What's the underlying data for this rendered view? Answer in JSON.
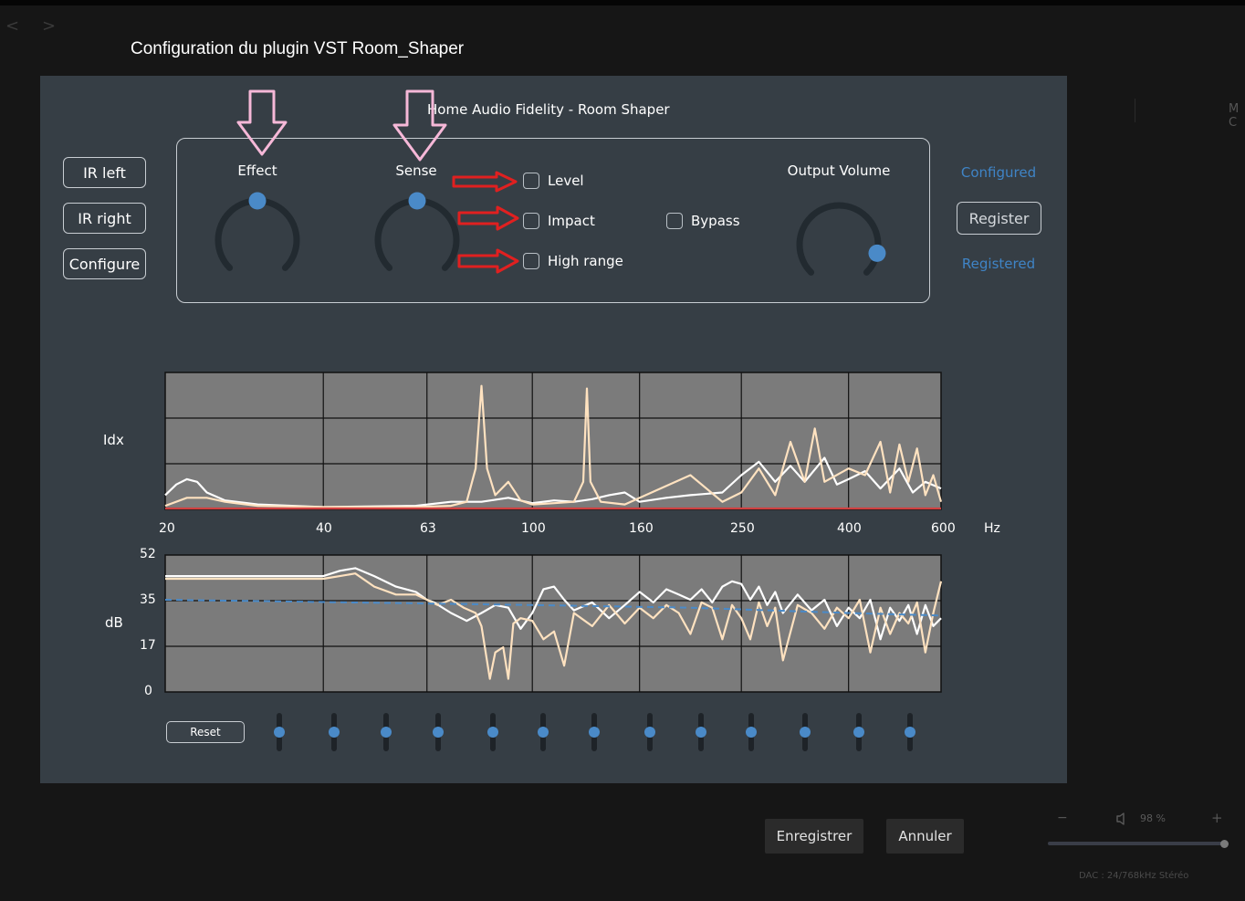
{
  "window": {
    "title": "Configuration du plugin VST Room_Shaper",
    "nav_back": "<",
    "nav_forward": ">",
    "right_edge_text": "M C"
  },
  "plugin": {
    "title": "Home Audio Fidelity - Room Shaper",
    "side_buttons": [
      "IR left",
      "IR right",
      "Configure"
    ],
    "knobs": {
      "effect": {
        "label": "Effect",
        "value": 0.5
      },
      "sense": {
        "label": "Sense",
        "value": 0.5
      },
      "output_volume": {
        "label": "Output Volume",
        "value": 0.88
      }
    },
    "checkboxes": {
      "level": {
        "label": "Level",
        "checked": false
      },
      "impact": {
        "label": "Impact",
        "checked": false
      },
      "high_range": {
        "label": "High range",
        "checked": false
      },
      "bypass": {
        "label": "Bypass",
        "checked": false
      }
    },
    "status": {
      "configured": "Configured",
      "register_button": "Register",
      "registered": "Registered"
    },
    "reset_label": "Reset",
    "eq_slider_values": [
      0.5,
      0.5,
      0.5,
      0.5,
      0.5,
      0.5,
      0.5,
      0.5,
      0.5,
      0.5,
      0.5,
      0.5,
      0.5
    ]
  },
  "chart_data": [
    {
      "type": "line",
      "ylabel": "Idx",
      "xlabel": "Hz",
      "x_scale": "log",
      "x_ticks": [
        "20",
        "40",
        "63",
        "100",
        "160",
        "250",
        "400",
        "600"
      ],
      "xlim": [
        20,
        600
      ],
      "series": [
        {
          "color": "#ffffff",
          "points": [
            [
              20,
              0.1
            ],
            [
              21,
              0.18
            ],
            [
              22,
              0.22
            ],
            [
              23,
              0.2
            ],
            [
              24,
              0.12
            ],
            [
              26,
              0.06
            ],
            [
              30,
              0.03
            ],
            [
              40,
              0.01
            ],
            [
              60,
              0.02
            ],
            [
              70,
              0.05
            ],
            [
              80,
              0.05
            ],
            [
              90,
              0.08
            ],
            [
              100,
              0.04
            ],
            [
              110,
              0.06
            ],
            [
              120,
              0.05
            ],
            [
              130,
              0.07
            ],
            [
              140,
              0.1
            ],
            [
              150,
              0.12
            ],
            [
              160,
              0.05
            ],
            [
              180,
              0.08
            ],
            [
              200,
              0.1
            ],
            [
              230,
              0.12
            ],
            [
              250,
              0.25
            ],
            [
              270,
              0.35
            ],
            [
              290,
              0.2
            ],
            [
              310,
              0.32
            ],
            [
              330,
              0.2
            ],
            [
              360,
              0.38
            ],
            [
              380,
              0.18
            ],
            [
              400,
              0.22
            ],
            [
              430,
              0.28
            ],
            [
              460,
              0.15
            ],
            [
              500,
              0.3
            ],
            [
              530,
              0.12
            ],
            [
              560,
              0.2
            ],
            [
              600,
              0.15
            ]
          ]
        },
        {
          "color": "#ffe2c0",
          "points": [
            [
              20,
              0.02
            ],
            [
              22,
              0.08
            ],
            [
              24,
              0.08
            ],
            [
              26,
              0.05
            ],
            [
              30,
              0.02
            ],
            [
              40,
              0.01
            ],
            [
              60,
              0.01
            ],
            [
              70,
              0.02
            ],
            [
              75,
              0.05
            ],
            [
              78,
              0.3
            ],
            [
              80,
              0.92
            ],
            [
              82,
              0.3
            ],
            [
              85,
              0.1
            ],
            [
              90,
              0.2
            ],
            [
              95,
              0.06
            ],
            [
              100,
              0.03
            ],
            [
              110,
              0.04
            ],
            [
              120,
              0.05
            ],
            [
              125,
              0.2
            ],
            [
              127,
              0.9
            ],
            [
              129,
              0.2
            ],
            [
              135,
              0.05
            ],
            [
              150,
              0.03
            ],
            [
              200,
              0.25
            ],
            [
              230,
              0.05
            ],
            [
              250,
              0.12
            ],
            [
              270,
              0.3
            ],
            [
              290,
              0.1
            ],
            [
              310,
              0.5
            ],
            [
              330,
              0.2
            ],
            [
              345,
              0.6
            ],
            [
              360,
              0.2
            ],
            [
              400,
              0.3
            ],
            [
              430,
              0.25
            ],
            [
              460,
              0.5
            ],
            [
              480,
              0.12
            ],
            [
              500,
              0.48
            ],
            [
              520,
              0.2
            ],
            [
              540,
              0.45
            ],
            [
              560,
              0.1
            ],
            [
              580,
              0.25
            ],
            [
              600,
              0.05
            ]
          ]
        },
        {
          "color": "#d04040",
          "points": [
            [
              20,
              0.0
            ],
            [
              600,
              0.0
            ]
          ]
        }
      ]
    },
    {
      "type": "line",
      "ylabel": "dB",
      "y_ticks": [
        "52",
        "35",
        "17",
        "0"
      ],
      "ylim": [
        0,
        52
      ],
      "x_scale": "log",
      "xlim": [
        20,
        600
      ],
      "series": [
        {
          "color": "#ffffff",
          "points": [
            [
              20,
              44
            ],
            [
              30,
              44
            ],
            [
              40,
              44
            ],
            [
              43,
              46
            ],
            [
              46,
              47
            ],
            [
              50,
              44
            ],
            [
              55,
              40
            ],
            [
              60,
              38
            ],
            [
              63,
              35
            ],
            [
              65,
              34
            ],
            [
              70,
              30
            ],
            [
              75,
              27
            ],
            [
              80,
              30
            ],
            [
              85,
              33
            ],
            [
              90,
              32
            ],
            [
              95,
              24
            ],
            [
              100,
              30
            ],
            [
              105,
              39
            ],
            [
              110,
              40
            ],
            [
              115,
              35
            ],
            [
              120,
              31
            ],
            [
              130,
              34
            ],
            [
              140,
              28
            ],
            [
              150,
              33
            ],
            [
              160,
              38
            ],
            [
              170,
              34
            ],
            [
              180,
              39
            ],
            [
              190,
              37
            ],
            [
              200,
              35
            ],
            [
              210,
              39
            ],
            [
              220,
              34
            ],
            [
              230,
              40
            ],
            [
              240,
              42
            ],
            [
              250,
              41
            ],
            [
              260,
              35
            ],
            [
              270,
              40
            ],
            [
              280,
              33
            ],
            [
              290,
              38
            ],
            [
              300,
              30
            ],
            [
              320,
              37
            ],
            [
              340,
              31
            ],
            [
              360,
              35
            ],
            [
              380,
              25
            ],
            [
              400,
              32
            ],
            [
              420,
              28
            ],
            [
              440,
              35
            ],
            [
              460,
              20
            ],
            [
              480,
              32
            ],
            [
              500,
              27
            ],
            [
              520,
              33
            ],
            [
              540,
              22
            ],
            [
              560,
              33
            ],
            [
              580,
              25
            ],
            [
              600,
              28
            ]
          ]
        },
        {
          "color": "#ffe2c0",
          "points": [
            [
              20,
              43
            ],
            [
              30,
              43
            ],
            [
              40,
              43
            ],
            [
              43,
              44
            ],
            [
              46,
              45
            ],
            [
              50,
              40
            ],
            [
              55,
              37
            ],
            [
              60,
              37
            ],
            [
              63,
              35
            ],
            [
              66,
              33
            ],
            [
              70,
              35
            ],
            [
              74,
              32
            ],
            [
              78,
              30
            ],
            [
              80,
              25
            ],
            [
              83,
              5
            ],
            [
              85,
              15
            ],
            [
              88,
              17
            ],
            [
              90,
              5
            ],
            [
              92,
              26
            ],
            [
              95,
              28
            ],
            [
              100,
              27
            ],
            [
              105,
              20
            ],
            [
              110,
              23
            ],
            [
              115,
              10
            ],
            [
              120,
              30
            ],
            [
              130,
              25
            ],
            [
              140,
              33
            ],
            [
              150,
              26
            ],
            [
              160,
              32
            ],
            [
              170,
              28
            ],
            [
              180,
              33
            ],
            [
              190,
              30
            ],
            [
              200,
              22
            ],
            [
              210,
              34
            ],
            [
              220,
              32
            ],
            [
              230,
              20
            ],
            [
              240,
              33
            ],
            [
              250,
              28
            ],
            [
              260,
              20
            ],
            [
              270,
              34
            ],
            [
              280,
              25
            ],
            [
              290,
              32
            ],
            [
              300,
              12
            ],
            [
              320,
              33
            ],
            [
              340,
              30
            ],
            [
              360,
              24
            ],
            [
              380,
              32
            ],
            [
              400,
              28
            ],
            [
              420,
              35
            ],
            [
              440,
              15
            ],
            [
              460,
              32
            ],
            [
              480,
              22
            ],
            [
              500,
              30
            ],
            [
              520,
              26
            ],
            [
              540,
              34
            ],
            [
              560,
              15
            ],
            [
              580,
              30
            ],
            [
              600,
              42
            ]
          ]
        },
        {
          "color": "#4a8ac8",
          "dashed": true,
          "points": [
            [
              20,
              35
            ],
            [
              100,
              33
            ],
            [
              200,
              32
            ],
            [
              400,
              30
            ],
            [
              600,
              29
            ]
          ]
        }
      ]
    }
  ],
  "footer": {
    "save_label": "Enregistrer",
    "cancel_label": "Annuler",
    "volume_minus": "−",
    "volume_plus": "+",
    "volume_percent": "98 %",
    "volume_value": 0.98,
    "dac_info": "DAC : 24/768kHz Stéréo"
  },
  "colors": {
    "plugin_bg": "#363e45",
    "plot_bg": "#7b7b7b",
    "accent": "#4a8ac8",
    "status_text": "#3f84c6"
  }
}
